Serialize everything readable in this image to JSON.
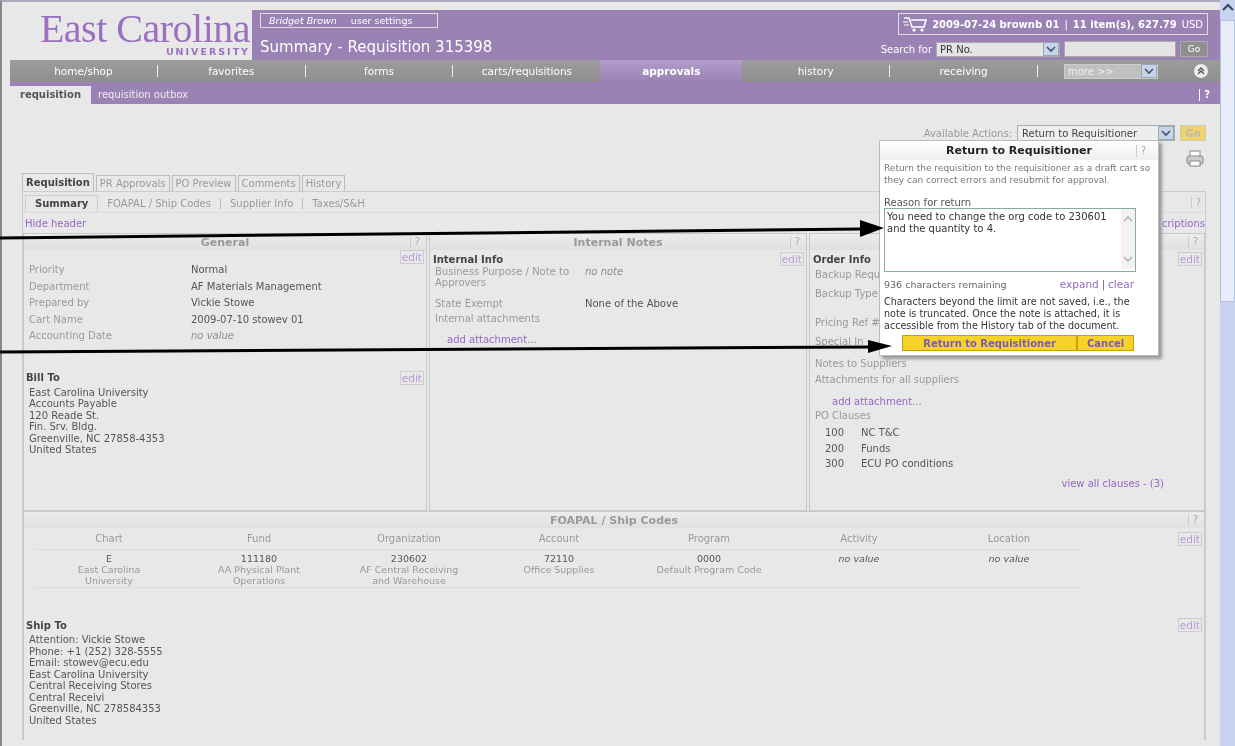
{
  "header": {
    "logo_name": "East Carolina",
    "logo_sub": "UNIVERSITY",
    "user": "Bridget Brown",
    "user_settings": "user settings",
    "page_title": "Summary - Requisition 315398",
    "cart": {
      "name": "2009-07-24 brownb 01",
      "separator": "|",
      "summary": "11 item(s), 627.79",
      "currency": "USD"
    },
    "search": {
      "label": "Search for",
      "type": "PR No.",
      "button": "Go"
    }
  },
  "nav": [
    {
      "label": "home/shop",
      "selected": false
    },
    {
      "label": "favorites",
      "selected": false
    },
    {
      "label": "forms",
      "selected": false
    },
    {
      "label": "carts/requisitions",
      "selected": false
    },
    {
      "label": "approvals",
      "selected": true
    },
    {
      "label": "history",
      "selected": false
    },
    {
      "label": "receiving",
      "selected": false
    }
  ],
  "nav_more": "more >>",
  "subnav": [
    {
      "label": "requisition",
      "selected": true
    },
    {
      "label": "requisition outbox",
      "selected": false
    }
  ],
  "subnav_help": "?",
  "actions": {
    "label": "Available Actions:",
    "value": "Return to Requisitioner",
    "button": "Go"
  },
  "doc_tabs": [
    {
      "label": "Requisition",
      "selected": true
    },
    {
      "label": "PR Approvals",
      "selected": false
    },
    {
      "label": "PO Preview",
      "selected": false
    },
    {
      "label": "Comments",
      "selected": false
    },
    {
      "label": "History",
      "selected": false
    }
  ],
  "section_tabs": [
    {
      "label": "Summary",
      "selected": true
    },
    {
      "label": "FOAPAL / Ship Codes",
      "selected": false
    },
    {
      "label": "Supplier Info",
      "selected": false
    },
    {
      "label": "Taxes/S&H",
      "selected": false
    }
  ],
  "section_help": "?",
  "hide_header": "Hide header",
  "descriptions_link": "criptions",
  "general": {
    "title": "General",
    "help": "?",
    "edit": "edit",
    "fields": [
      {
        "label": "Priority",
        "value": "Normal",
        "empty": false
      },
      {
        "label": "Department",
        "value": "AF Materials Management",
        "empty": false
      },
      {
        "label": "Prepared by",
        "value": "Vickie Stowe",
        "empty": false
      },
      {
        "label": "Cart Name",
        "value": "2009-07-10 stowev 01",
        "empty": false
      },
      {
        "label": "Accounting Date",
        "value": "no value",
        "empty": true
      }
    ],
    "bill_to": {
      "title": "Bill To",
      "edit": "edit",
      "lines": [
        "East Carolina University",
        "Accounts Payable",
        "120 Reade St.",
        "Fin. Srv. Bldg.",
        "Greenville, NC 27858-4353",
        "United States"
      ]
    }
  },
  "internal": {
    "title": "Internal Notes",
    "help": "?",
    "edit": "edit",
    "heading": "Internal Info",
    "fields": [
      {
        "label": "Business Purpose / Note to Approvers",
        "value": "no note",
        "empty": true
      },
      {
        "label": "State Exempt",
        "value": "None of the Above",
        "empty": false
      },
      {
        "label": "Internal attachments"
      }
    ],
    "link": "add attachment..."
  },
  "order": {
    "help": "?",
    "edit": "edit",
    "heading": "Order Info",
    "labels": [
      "Backup Requ",
      "Backup Type",
      "Pricing Ref #",
      "Special In"
    ],
    "notes_label": "Notes to Suppliers",
    "attachments": "Attachments for all suppliers",
    "link": "add attachment...",
    "clauses_title": "PO Clauses",
    "clauses": [
      {
        "code": "100",
        "name": "NC T&C"
      },
      {
        "code": "200",
        "name": "Funds"
      },
      {
        "code": "300",
        "name": "ECU PO conditions"
      }
    ],
    "view_all": "view all clauses - (3)"
  },
  "foapal": {
    "title": "FOAPAL / Ship Codes",
    "help": "?",
    "edit": "edit",
    "columns": [
      "Chart",
      "Fund",
      "Organization",
      "Account",
      "Program",
      "Activity",
      "Location"
    ],
    "cells": [
      {
        "code": "E",
        "desc": "East Carolina University",
        "empty": false
      },
      {
        "code": "111180",
        "desc": "AA Physical Plant Operations",
        "empty": false
      },
      {
        "code": "230602",
        "desc": "AF Central Receiving and Warehouse",
        "empty": false
      },
      {
        "code": "72110",
        "desc": "Office Supplies",
        "empty": false
      },
      {
        "code": "0000",
        "desc": "Default Program Code",
        "empty": false
      },
      {
        "code": "no value",
        "empty": true
      },
      {
        "code": "no value",
        "empty": true
      }
    ],
    "ship_to": {
      "title": "Ship To",
      "edit": "edit",
      "lines": [
        "Attention: Vickie Stowe",
        "Phone: +1 (252) 328-5555",
        "Email: stowev@ecu.edu",
        "East Carolina University",
        "Central Receiving Stores",
        "Central Receivi",
        "Greenville, NC 278584353",
        "United States"
      ]
    }
  },
  "dialog": {
    "title": "Return to Requisitioner",
    "help": "?",
    "description": "Return the requisition to the requisitioner as a draft cart so they can correct errors and resubmit for approval.",
    "reason_label": "Reason for return",
    "reason": "You need to change the org code to 230601 and the quantity to 4.",
    "remaining": "936 characters remaining",
    "expand": "expand",
    "separator": "|",
    "clear": "clear",
    "note": "Characters beyond the limit are not saved, i.e., the note is truncated. Once the note is attached, it is accessible from the History tab of the document.",
    "buttons": [
      {
        "label": "Return to Requisitioner",
        "kind": "primary"
      },
      {
        "label": "Cancel",
        "kind": "secondary"
      }
    ]
  }
}
